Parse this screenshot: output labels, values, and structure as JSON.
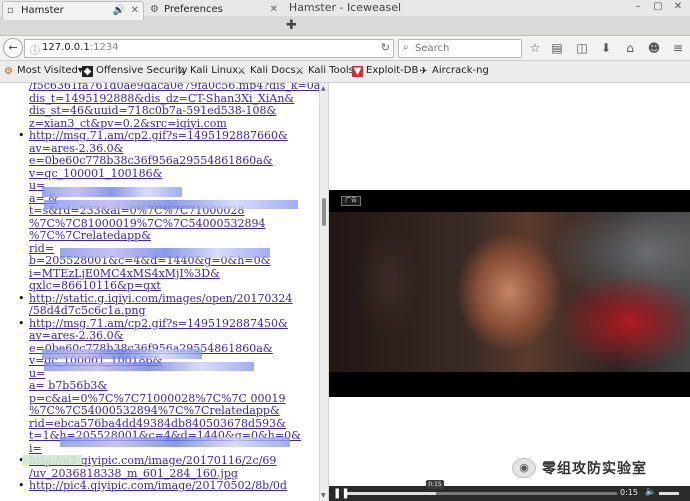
{
  "window": {
    "title": "Hamster - Iceweasel"
  },
  "tabs": [
    {
      "label": "Hamster"
    },
    {
      "label": "Preferences"
    }
  ],
  "navbar": {
    "url_host": "127.0.0.1",
    "url_port": ":1234",
    "search_placeholder": "Search"
  },
  "bookmarks": [
    {
      "label": "Most Visited▾",
      "icon": "gear-icon"
    },
    {
      "label": "Offensive Security",
      "icon": "offsec-icon"
    },
    {
      "label": "Kali Linux",
      "icon": "kali-dragon-icon"
    },
    {
      "label": "Kali Docs",
      "icon": "kali-dragon-icon"
    },
    {
      "label": "Kali Tools",
      "icon": "kali-dragon-icon"
    },
    {
      "label": "Exploit-DB",
      "icon": "exploitdb-icon"
    },
    {
      "label": "Aircrack-ng",
      "icon": "aircrack-icon"
    }
  ],
  "links": [
    {
      "lines": [
        "/f5c6361fa761d0ae9daca0e79fa0c56.mp4?dis_k=0a0",
        "dis_t=1495192888&dis_dz=CT-Shan3Xi_XiAn&",
        "dis_st=46&uuid=718c0b7a-591ed538-108&",
        "z=xian3_ct&pv=0.2&src=iqiyi.com"
      ],
      "bullet": false
    },
    {
      "lines": [
        "http://msg.71.am/cp2.gif?s=1495192887660&",
        "av=ares-2.36.0&",
        "e=0be60c778b38c36f956a29554861860a&",
        "v=qc_100001_100186&",
        "u=",
        "a=                                              &",
        "t=s&rd=233&ai=0%7C%7C71000028",
        "%7C%7C81000019%7C%7C54000532894",
        "%7C%7Crelatedapp&",
        "rid=",
        "b=205528001&c=4&d=1440&g=0&h=0&",
        "i=MTEzLjE0MC4xMS4xMjI%3D&",
        "qxlc=86610116&p=qxt"
      ],
      "bullet": true
    },
    {
      "lines": [
        "http://static.g.iqiyi.com/images/open/20170324",
        "/58d4d7c5c6c1a.png"
      ],
      "bullet": true
    },
    {
      "lines": [
        "http://msg.71.am/cp2.gif?s=1495192887450&",
        "av=ares-2.36.0&",
        "e=0be60c778b38c36f956a29554861860a&",
        "v=qc_100001_100186&",
        "u=",
        "a=                                        b7b56b3&",
        "p=c&ai=0%7C%7C71000028%7C%7C    00019",
        "%7C%7C54000532894%7C%7Crelatedapp&",
        "rid=ebca576ba4dd49384db840503678d593&",
        "t=1&h=205528001&c=4&d=1440&g=0&h=0&",
        "i="
      ],
      "bullet": true
    },
    {
      "lines": [
        "http://u2.qiyipic.com/image/20170116/2c/69",
        "/uv_2036818338_m_601_284_160.jpg"
      ],
      "bullet": true
    },
    {
      "lines": [
        "http://pic4.qiyipic.com/image/20170502/8b/0d"
      ],
      "bullet": true
    }
  ],
  "video": {
    "tag": "广告",
    "timecode": "0:15",
    "progress_fraction": 0.33
  },
  "watermark": {
    "text": "零组攻防实验室"
  }
}
